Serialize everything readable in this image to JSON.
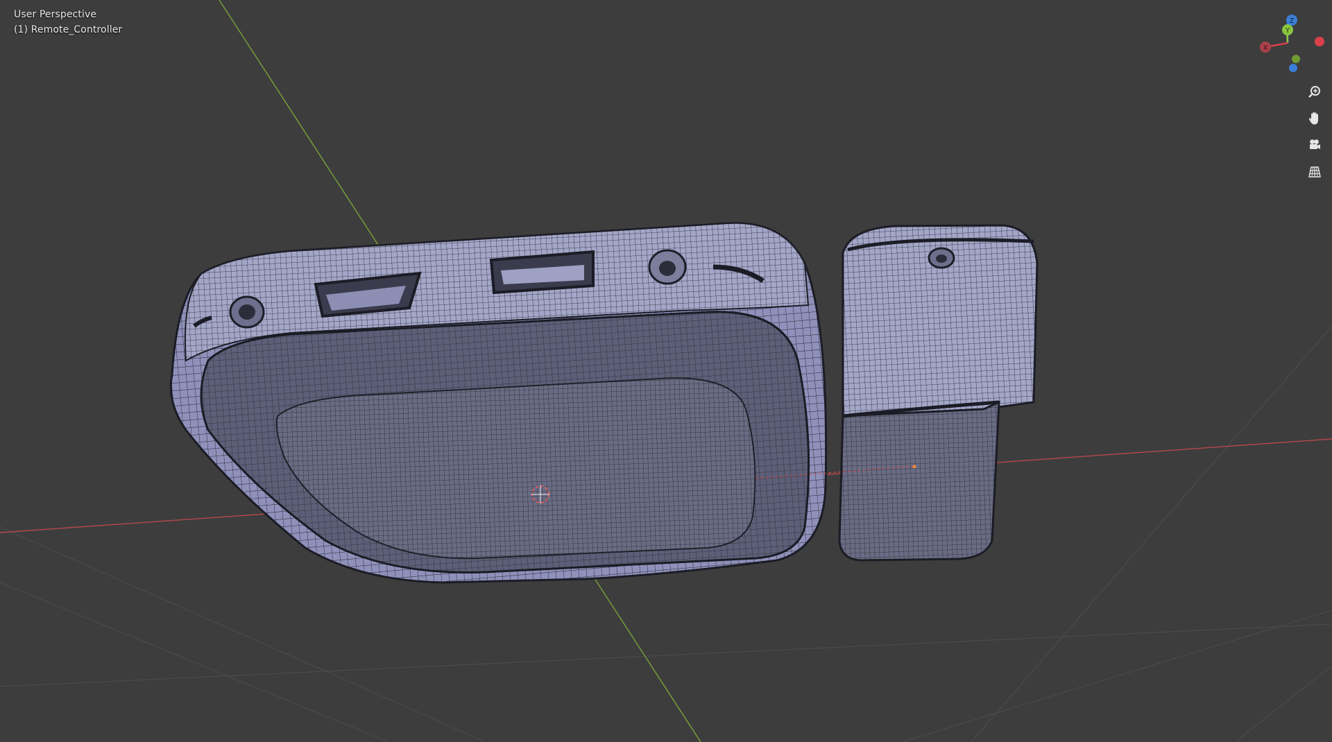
{
  "viewport": {
    "view_mode": "User Perspective",
    "object_label": "(1) Remote_Controller"
  },
  "gizmo": {
    "axes": [
      {
        "name": "x-axis",
        "label": "X",
        "color": "#d9404c"
      },
      {
        "name": "y-axis",
        "label": "Y",
        "color": "#8bc53f"
      },
      {
        "name": "z-axis",
        "label": "Z",
        "color": "#3a7fd6"
      }
    ]
  },
  "nav_controls": [
    {
      "name": "zoom-icon",
      "tool": "zoom"
    },
    {
      "name": "pan-hand-icon",
      "tool": "pan"
    },
    {
      "name": "camera-icon",
      "tool": "camera-view"
    },
    {
      "name": "ortho-grid-icon",
      "tool": "toggle-perspective"
    }
  ],
  "colors": {
    "background": "#3d3d3d",
    "mesh_face": "#9a9cc6",
    "mesh_wire": "#1e1f2a",
    "x_axis_line": "#b8484c",
    "y_axis_line": "#7aa33a",
    "grid_line": "#4a4a4a"
  }
}
